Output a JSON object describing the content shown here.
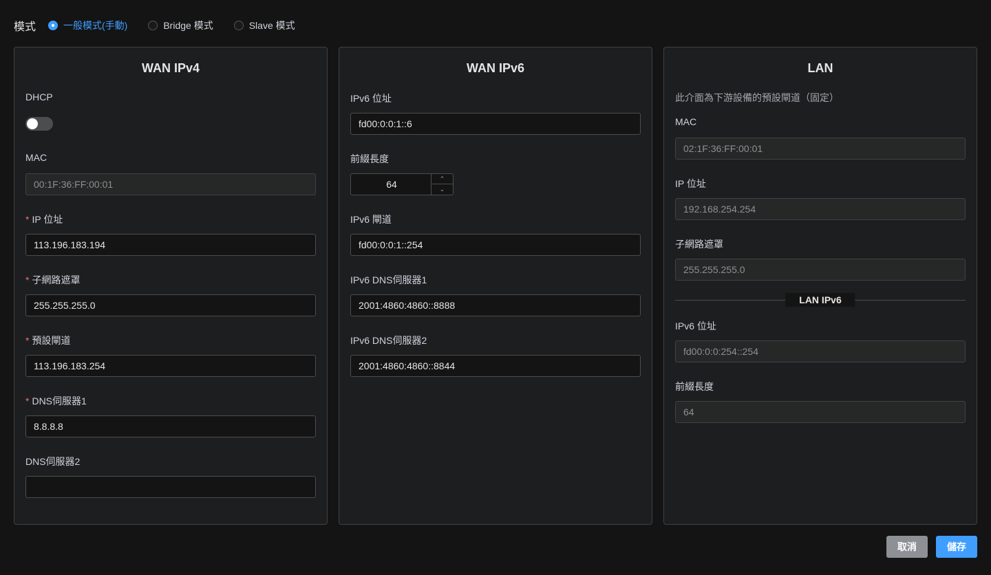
{
  "mode": {
    "label": "模式",
    "options": [
      {
        "label": "一般模式(手動)",
        "checked": true
      },
      {
        "label": "Bridge 模式",
        "checked": false
      },
      {
        "label": "Slave 模式",
        "checked": false
      }
    ]
  },
  "wan_ipv4": {
    "title": "WAN IPv4",
    "dhcp_label": "DHCP",
    "dhcp_enabled": false,
    "mac_label": "MAC",
    "mac_value": "00:1F:36:FF:00:01",
    "ip_label": "IP 位址",
    "ip_value": "113.196.183.194",
    "mask_label": "子網路遮罩",
    "mask_value": "255.255.255.0",
    "gateway_label": "預設閘道",
    "gateway_value": "113.196.183.254",
    "dns1_label": "DNS伺服器1",
    "dns1_value": "8.8.8.8",
    "dns2_label": "DNS伺服器2",
    "dns2_value": "",
    "required_mark": "*"
  },
  "wan_ipv6": {
    "title": "WAN IPv6",
    "addr_label": "IPv6 位址",
    "addr_value": "fd00:0:0:1::6",
    "prefix_label": "前綴長度",
    "prefix_value": "64",
    "gateway_label": "IPv6 閘道",
    "gateway_value": "fd00:0:0:1::254",
    "dns1_label": "IPv6 DNS伺服器1",
    "dns1_value": "2001:4860:4860::8888",
    "dns2_label": "IPv6 DNS伺服器2",
    "dns2_value": "2001:4860:4860::8844"
  },
  "lan": {
    "title": "LAN",
    "note": "此介面為下游設備的預設閘道（固定）",
    "mac_label": "MAC",
    "mac_value": "02:1F:36:FF:00:01",
    "ip_label": "IP 位址",
    "ip_value": "192.168.254.254",
    "mask_label": "子網路遮罩",
    "mask_value": "255.255.255.0",
    "ipv6_section": "LAN IPv6",
    "ipv6_addr_label": "IPv6 位址",
    "ipv6_addr_value": "fd00:0:0:254::254",
    "prefix_label": "前綴長度",
    "prefix_value": "64"
  },
  "actions": {
    "cancel": "取消",
    "save": "儲存"
  },
  "colors": {
    "accent": "#409eff",
    "required": "#f56c6c",
    "cancel_bg": "#8d9095"
  },
  "icons": {
    "stepper_up": "chevron-up-icon",
    "stepper_down": "chevron-down-icon"
  }
}
